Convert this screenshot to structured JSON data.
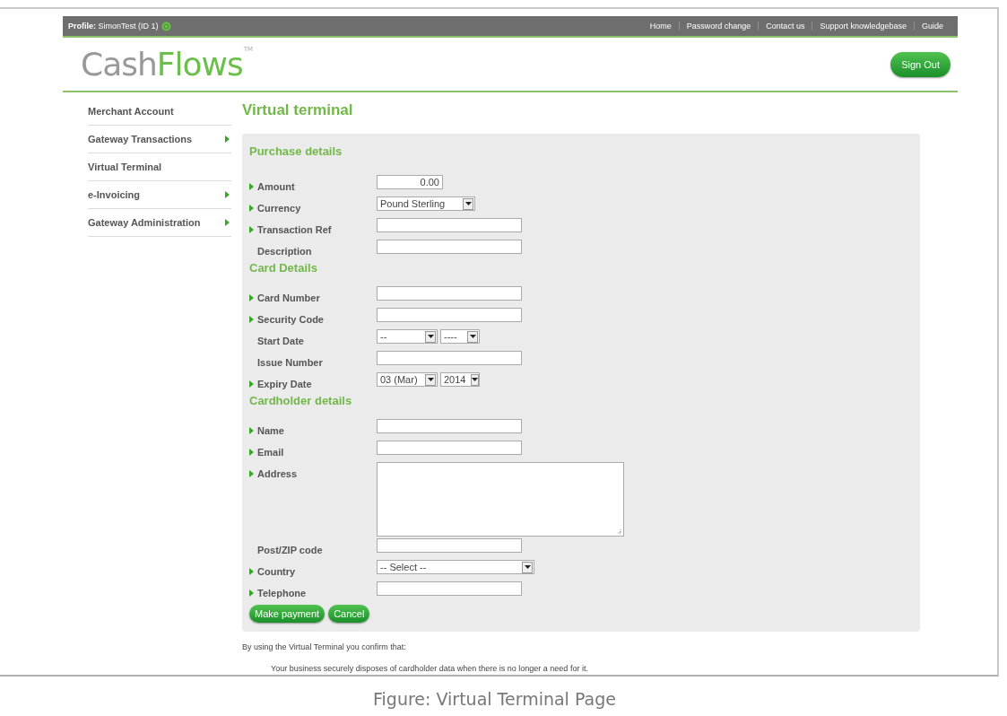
{
  "top_bar": {
    "profile_label": "Profile:",
    "profile_name": "SimonTest (ID 1)",
    "links": [
      "Home",
      "Password change",
      "Contact us",
      "Support knowledgebase",
      "Guide"
    ]
  },
  "logo": {
    "first": "Cash",
    "second": "Flows",
    "mark": "TM"
  },
  "sign_out": "Sign Out",
  "sidebar": {
    "items": [
      {
        "label": "Merchant Account",
        "submenu": false
      },
      {
        "label": "Gateway Transactions",
        "submenu": true
      },
      {
        "label": "Virtual Terminal",
        "submenu": false
      },
      {
        "label": "e-Invoicing",
        "submenu": true
      },
      {
        "label": "Gateway Administration",
        "submenu": true
      }
    ]
  },
  "page_title": "Virtual terminal",
  "sections": [
    {
      "title": "Purchase details",
      "fields": [
        {
          "label": "Amount",
          "required": true,
          "kind": "amount",
          "value": "0.00"
        },
        {
          "label": "Currency",
          "required": true,
          "kind": "select",
          "value": "Pound Sterling"
        },
        {
          "label": "Transaction Ref",
          "required": true,
          "kind": "text"
        },
        {
          "label": "Description",
          "required": false,
          "kind": "text"
        }
      ]
    },
    {
      "title": "Card Details",
      "fields": [
        {
          "label": "Card Number",
          "required": true,
          "kind": "text"
        },
        {
          "label": "Security Code",
          "required": true,
          "kind": "text"
        },
        {
          "label": "Start Date",
          "required": false,
          "kind": "date",
          "values": [
            "--",
            "----"
          ]
        },
        {
          "label": "Issue Number",
          "required": false,
          "kind": "text"
        },
        {
          "label": "Expiry Date",
          "required": true,
          "kind": "date",
          "values": [
            "03 (Mar)",
            "2014"
          ]
        }
      ]
    },
    {
      "title": "Cardholder details",
      "fields": [
        {
          "label": "Name",
          "required": true,
          "kind": "text"
        },
        {
          "label": "Email",
          "required": true,
          "kind": "text"
        },
        {
          "label": "Address",
          "required": true,
          "kind": "textarea"
        },
        {
          "label": "Post/ZIP code",
          "required": false,
          "kind": "text"
        },
        {
          "label": "Country",
          "required": true,
          "kind": "wide_select",
          "value": "-- Select --"
        },
        {
          "label": "Telephone",
          "required": true,
          "kind": "text"
        }
      ]
    }
  ],
  "buttons": [
    "Make payment",
    "Cancel"
  ],
  "notice": "By using the Virtual Terminal you confirm that:",
  "notice_items": [
    "Your business securely disposes of cardholder data when there is no longer a need for it."
  ],
  "caption": "Figure: Virtual Terminal Page"
}
